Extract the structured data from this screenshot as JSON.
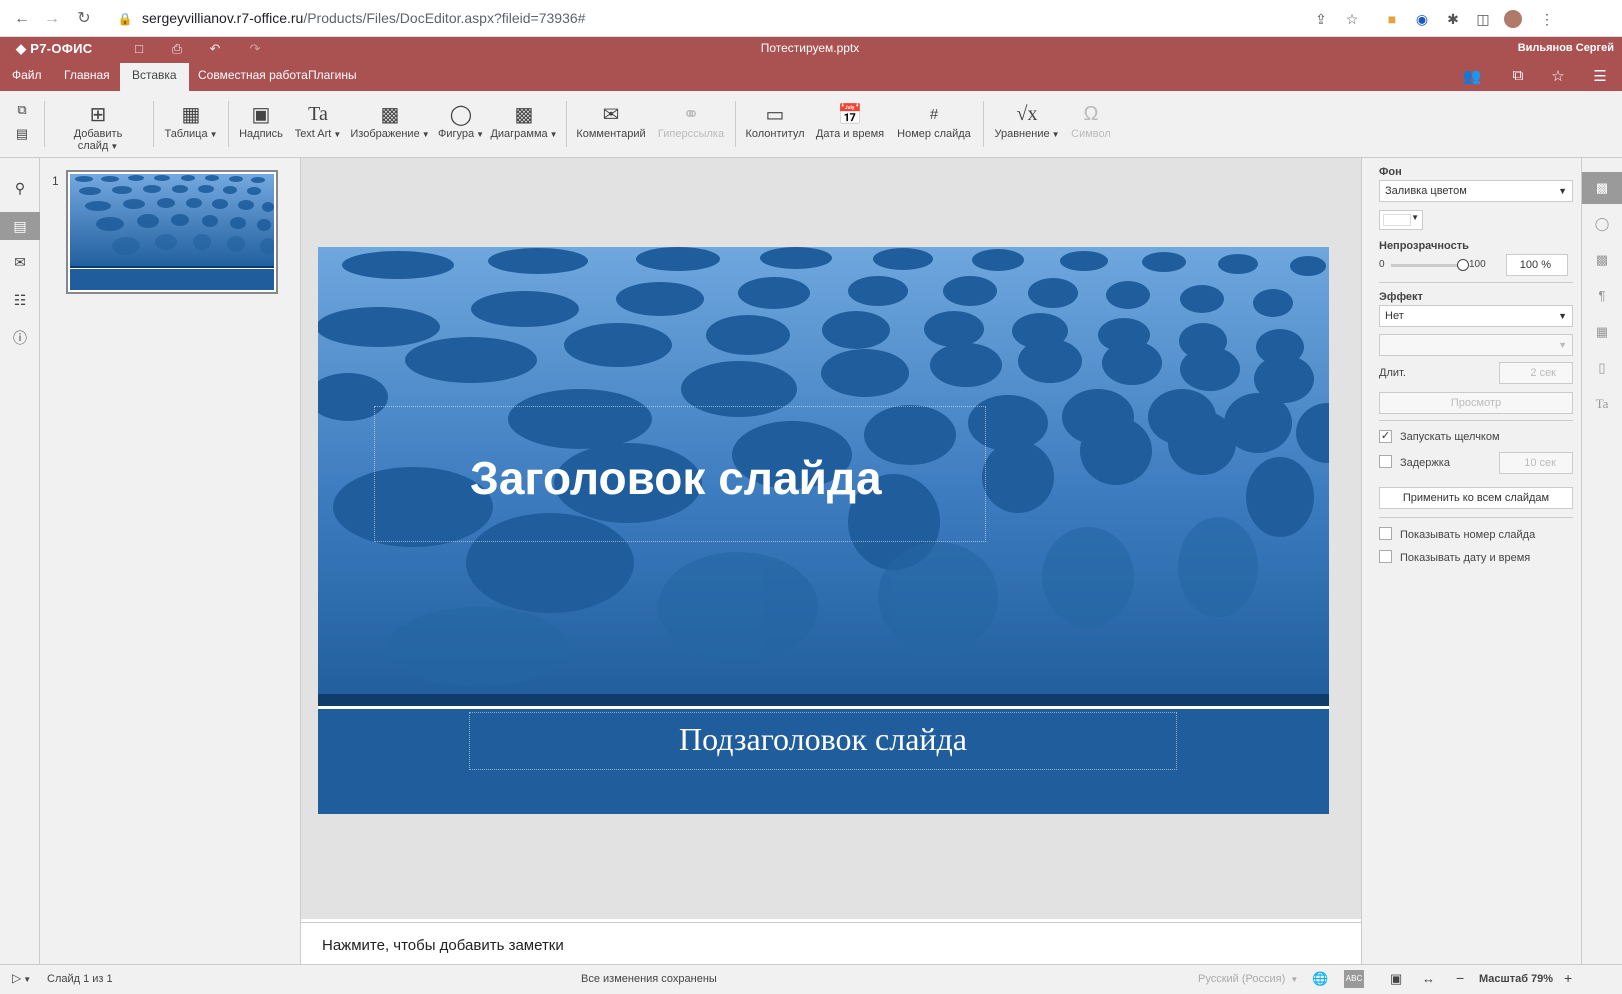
{
  "browser": {
    "url_main": "sergeyvillianov.r7-office.ru",
    "url_path": "/Products/Files/DocEditor.aspx?fileid=73936#"
  },
  "app": {
    "logo": "Р7-ОФИС",
    "doc_title": "Потестируем.pptx",
    "user_name": "Вильянов Сергей",
    "brand_color": "#aa5252"
  },
  "menu": {
    "tabs": [
      "Файл",
      "Главная",
      "Вставка",
      "Совместная работа",
      "Плагины"
    ],
    "active": "Вставка"
  },
  "toolbar": {
    "add_slide": "Добавить слайд",
    "table": "Таблица",
    "text_box": "Надпись",
    "text_art": "Text Art",
    "image": "Изображение",
    "shape": "Фигура",
    "chart": "Диаграмма",
    "comment": "Комментарий",
    "hyperlink": "Гиперссылка",
    "header_footer": "Колонтитул",
    "date_time": "Дата и время",
    "slide_number": "Номер слайда",
    "equation": "Уравнение",
    "symbol": "Символ"
  },
  "thumbs": {
    "slide_number": "1"
  },
  "slide": {
    "title": "Заголовок слайда",
    "subtitle": "Подзаголовок слайда"
  },
  "notes": {
    "placeholder": "Нажмите, чтобы добавить заметки"
  },
  "settings": {
    "background_label": "Фон",
    "background_fill": "Заливка цветом",
    "opacity_label": "Непрозрачность",
    "opacity_min": "0",
    "opacity_max": "100",
    "opacity_value": "100 %",
    "opacity_level": 1.0,
    "effect_label": "Эффект",
    "effect_value": "Нет",
    "duration_label": "Длит.",
    "duration_value": "2 сек",
    "preview_button": "Просмотр",
    "start_on_click_label": "Запускать щелчком",
    "start_on_click_checked": true,
    "delay_label": "Задержка",
    "delay_value": "10 сек",
    "delay_checked": false,
    "apply_all_button": "Применить ко всем слайдам",
    "show_slide_number_label": "Показывать номер слайда",
    "show_date_time_label": "Показывать дату и время"
  },
  "status": {
    "slide_info": "Слайд 1 из 1",
    "save_status": "Все изменения сохранены",
    "language": "Русский (Россия)",
    "zoom": "Масштаб 79%"
  }
}
